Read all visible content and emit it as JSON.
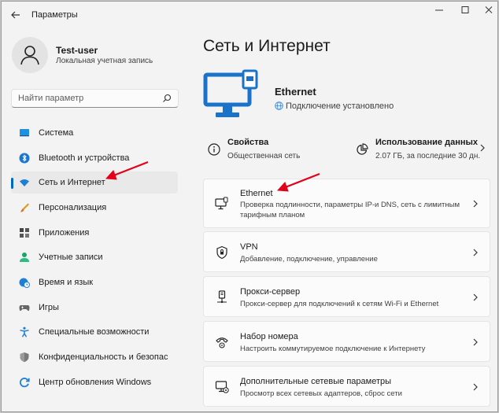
{
  "window": {
    "title": "Параметры"
  },
  "user": {
    "name": "Test-user",
    "account_type": "Локальная учетная запись"
  },
  "search": {
    "placeholder": "Найти параметр"
  },
  "sidebar": {
    "items": [
      {
        "label": "Система",
        "icon": "monitor-icon"
      },
      {
        "label": "Bluetooth и устройства",
        "icon": "bluetooth-icon"
      },
      {
        "label": "Сеть и Интернет",
        "icon": "wifi-icon",
        "active": true
      },
      {
        "label": "Персонализация",
        "icon": "brush-icon"
      },
      {
        "label": "Приложения",
        "icon": "apps-icon"
      },
      {
        "label": "Учетные записи",
        "icon": "person-icon"
      },
      {
        "label": "Время и язык",
        "icon": "clock-globe-icon"
      },
      {
        "label": "Игры",
        "icon": "gamepad-icon"
      },
      {
        "label": "Специальные возможности",
        "icon": "accessibility-icon"
      },
      {
        "label": "Конфиденциальность и безопас",
        "icon": "shield-icon"
      },
      {
        "label": "Центр обновления Windows",
        "icon": "update-icon"
      }
    ]
  },
  "main": {
    "title": "Сеть и Интернет",
    "connection": {
      "name": "Ethernet",
      "status": "Подключение установлено"
    },
    "properties": {
      "title": "Свойства",
      "subtitle": "Общественная сеть"
    },
    "data_usage": {
      "title": "Использование данных",
      "subtitle": "2.07 ГБ, за последние 30 дн."
    },
    "cards": [
      {
        "title": "Ethernet",
        "subtitle": "Проверка подлинности, параметры IP-и DNS, сеть с лимитным тарифным планом",
        "icon": "ethernet-icon"
      },
      {
        "title": "VPN",
        "subtitle": "Добавление, подключение, управление",
        "icon": "vpn-shield-icon"
      },
      {
        "title": "Прокси-сервер",
        "subtitle": "Прокси-сервер для подключений к сетям Wi-Fi и Ethernet",
        "icon": "proxy-icon"
      },
      {
        "title": "Набор номера",
        "subtitle": "Настроить коммутируемое подключение к Интернету",
        "icon": "dialup-icon"
      },
      {
        "title": "Дополнительные сетевые параметры",
        "subtitle": "Просмотр всех сетевых адаптеров, сброс сети",
        "icon": "advanced-network-icon"
      }
    ]
  },
  "colors": {
    "accent": "#0067c0",
    "annotation": "#e3001b",
    "window_bg": "#f3f3f3"
  }
}
